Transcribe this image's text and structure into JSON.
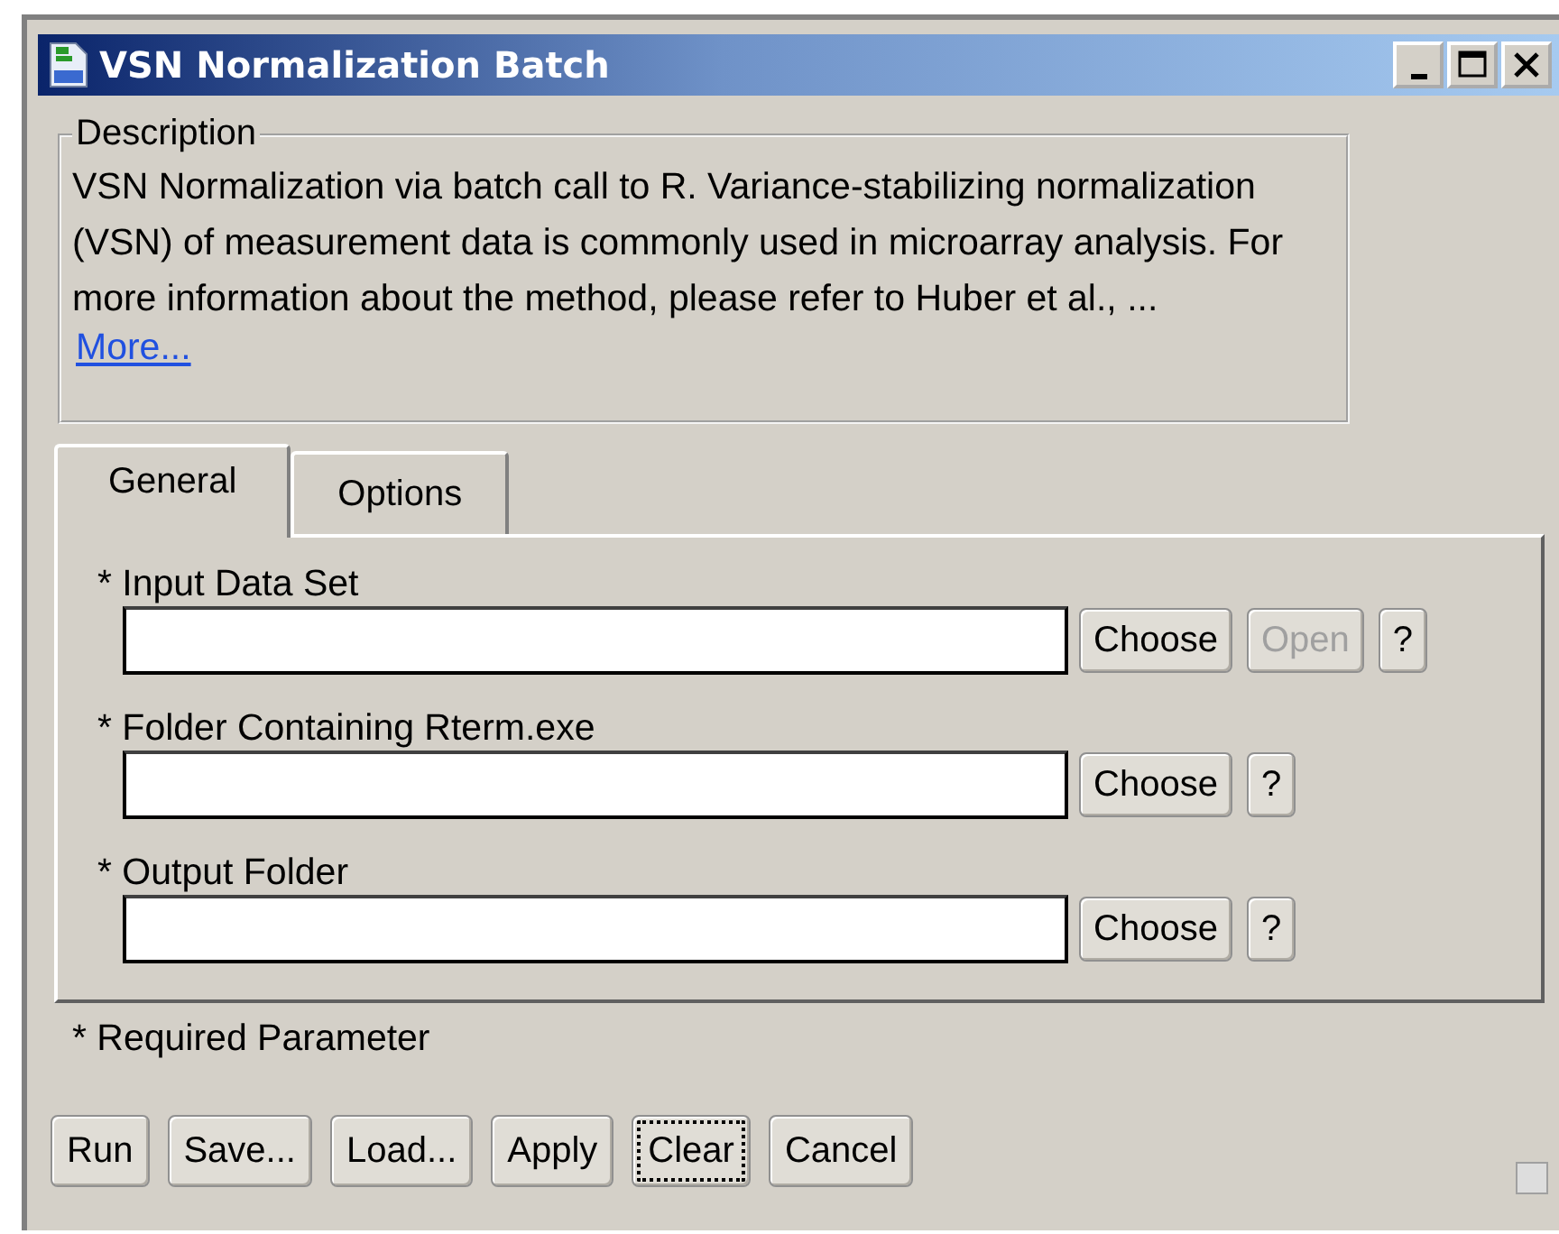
{
  "window": {
    "title": "VSN Normalization Batch",
    "controls": [
      {
        "kind": "minimize"
      },
      {
        "kind": "maximize"
      },
      {
        "kind": "close"
      }
    ]
  },
  "description": {
    "legend": "Description",
    "text": "VSN Normalization via batch call to R. Variance-stabilizing normalization (VSN) of measurement data is commonly used in microarray analysis. For more information about the method, please refer to Huber et al., ...",
    "link": "More..."
  },
  "tabs": [
    {
      "label": "General",
      "selected": true
    },
    {
      "label": "Options",
      "selected": false
    }
  ],
  "parameters": [
    {
      "label": "* Input Data Set",
      "buttons": [
        {
          "label": "Choose",
          "disabled": false
        },
        {
          "label": "Open",
          "disabled": true
        },
        {
          "label": "?",
          "disabled": false
        }
      ]
    },
    {
      "label": "* Folder Containing Rterm.exe",
      "buttons": [
        {
          "label": "Choose",
          "disabled": false
        },
        {
          "label": "?",
          "disabled": false
        }
      ]
    },
    {
      "label": "* Output Folder",
      "buttons": [
        {
          "label": "Choose",
          "disabled": false
        },
        {
          "label": "?",
          "disabled": false
        }
      ]
    }
  ],
  "required_note": "* Required Parameter",
  "buttons": [
    {
      "label": "Run",
      "focused": false
    },
    {
      "label": "Save...",
      "focused": false
    },
    {
      "label": "Load...",
      "focused": false
    },
    {
      "label": "Apply",
      "focused": false
    },
    {
      "label": "Clear",
      "focused": true
    },
    {
      "label": "Cancel",
      "focused": false
    }
  ]
}
